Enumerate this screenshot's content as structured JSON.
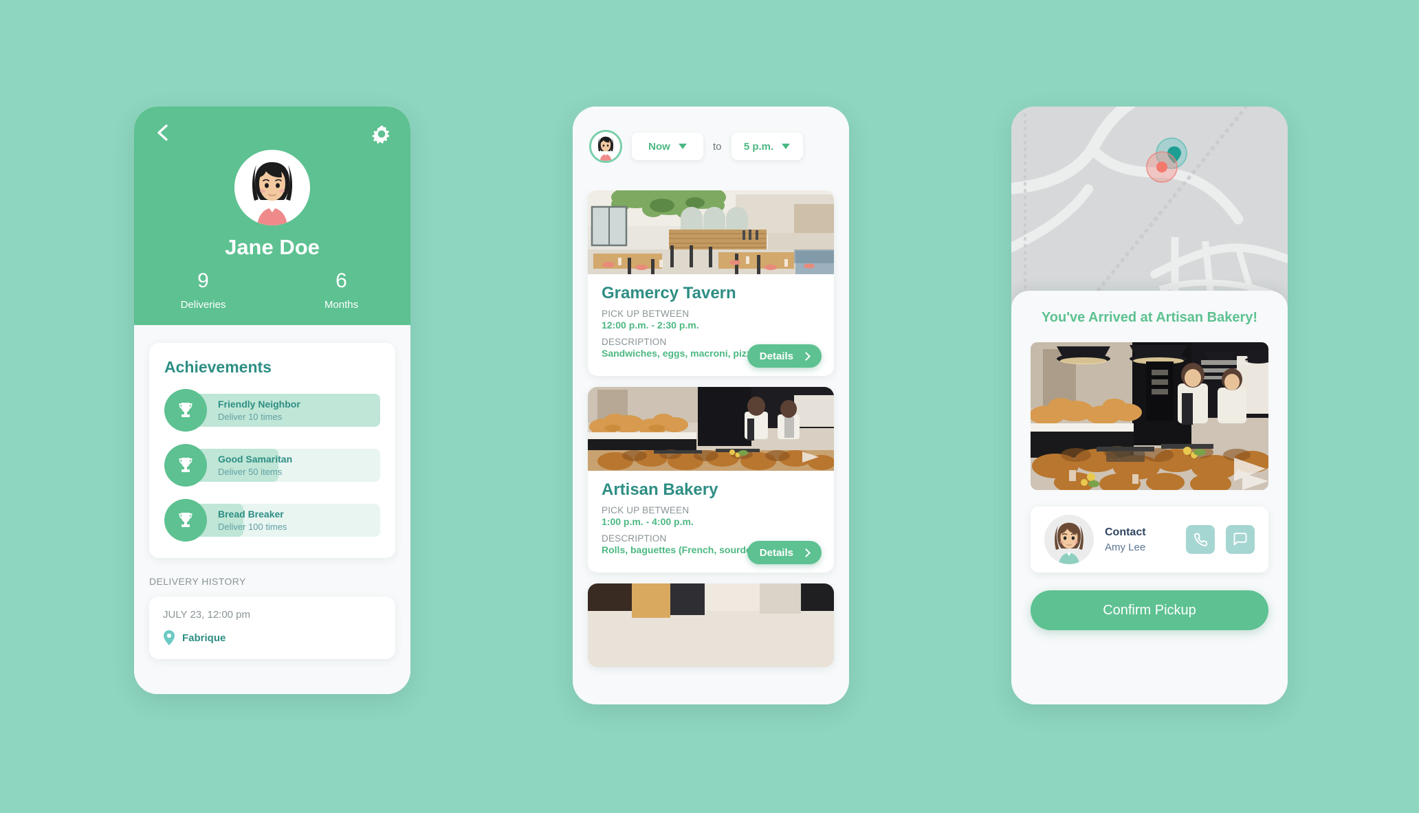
{
  "theme": {
    "background": "#8ed6c0",
    "brand_green": "#5dc191",
    "accent_green": "#4cb882",
    "teal_dark": "#2e8e84",
    "muted_gray": "#8a9496",
    "navy": "#2e4560",
    "icon_tile": "#a6d6d2"
  },
  "profile_screen": {
    "back_icon": "chevron-left-icon",
    "settings_icon": "gear-icon",
    "avatar_icon": "user-avatar-jane",
    "name": "Jane Doe",
    "stats": [
      {
        "value": "9",
        "label": "Deliveries"
      },
      {
        "value": "6",
        "label": "Months"
      }
    ],
    "achievements": {
      "title": "Achievements",
      "items": [
        {
          "name": "Friendly Neighbor",
          "desc": "Deliver 10 times",
          "progress_pct": 100,
          "icon": "trophy-icon"
        },
        {
          "name": "Good Samaritan",
          "desc": "Deliver 50 items",
          "progress_pct": 48,
          "icon": "trophy-icon"
        },
        {
          "name": "Bread Breaker",
          "desc": "Deliver 100 times",
          "progress_pct": 30,
          "icon": "trophy-icon"
        }
      ]
    },
    "history": {
      "label": "DELIVERY HISTORY",
      "entries": [
        {
          "date": "JULY 23, 12:00 pm",
          "place": "Fabrique",
          "pin_icon": "location-pin-icon"
        }
      ]
    }
  },
  "list_screen": {
    "avatar_icon": "user-avatar-jane",
    "time_from": "Now",
    "time_to": "5 p.m.",
    "to_word": "to",
    "caret_icon": "caret-down-icon",
    "labels": {
      "pickup": "PICK UP BETWEEN",
      "description": "DESCRIPTION",
      "details_button": "Details",
      "chevron_icon": "chevron-right-icon"
    },
    "venues": [
      {
        "name": "Gramercy Tavern",
        "pickup_window": "12:00 p.m. - 2:30 p.m.",
        "description": "Sandwiches, eggs, macroni, pizza",
        "photo": "restaurant-interior-photo"
      },
      {
        "name": "Artisan Bakery",
        "pickup_window": "1:00 p.m. - 4:00 p.m.",
        "description": "Rolls, baguettes (French, sourdough, rye)",
        "photo": "bakery-counter-photo"
      },
      {
        "name": "",
        "pickup_window": "",
        "description": "",
        "photo": "cafe-interior-photo-partial"
      }
    ]
  },
  "arrived_screen": {
    "map": {
      "icon": "map-view",
      "destination_marker": "teal-pin-marker",
      "user_marker": "red-location-dot"
    },
    "title": "You've Arrived at Artisan Bakery!",
    "photo": "bakery-counter-photo",
    "contact": {
      "avatar_icon": "user-avatar-amy",
      "title": "Contact",
      "name": "Amy Lee",
      "call_icon": "phone-icon",
      "message_icon": "chat-bubble-icon"
    },
    "confirm_button": "Confirm Pickup"
  }
}
